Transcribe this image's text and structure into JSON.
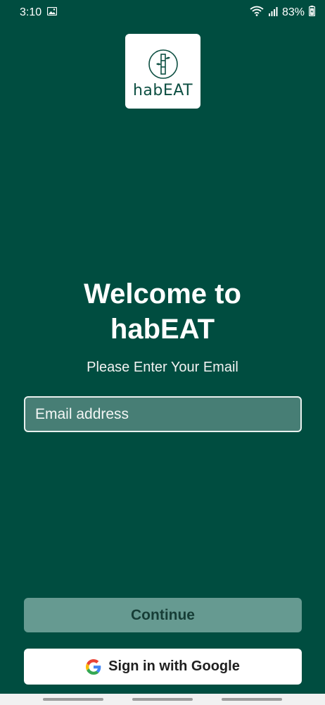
{
  "status_bar": {
    "time": "3:10",
    "battery_percent": "83%",
    "icons": [
      "image-icon",
      "wifi-icon",
      "signal-icon",
      "battery-icon"
    ]
  },
  "logo": {
    "text": "habEAT",
    "icon": "bamboo-icon"
  },
  "welcome": {
    "title_line1": "Welcome to",
    "title_line2": "habEAT",
    "subtitle": "Please Enter Your Email"
  },
  "email": {
    "placeholder": "Email address",
    "value": ""
  },
  "buttons": {
    "continue_label": "Continue",
    "google_label": "Sign in with Google"
  },
  "colors": {
    "background": "#004d40",
    "continue_bg": "#669a91",
    "google_bg": "#ffffff"
  }
}
